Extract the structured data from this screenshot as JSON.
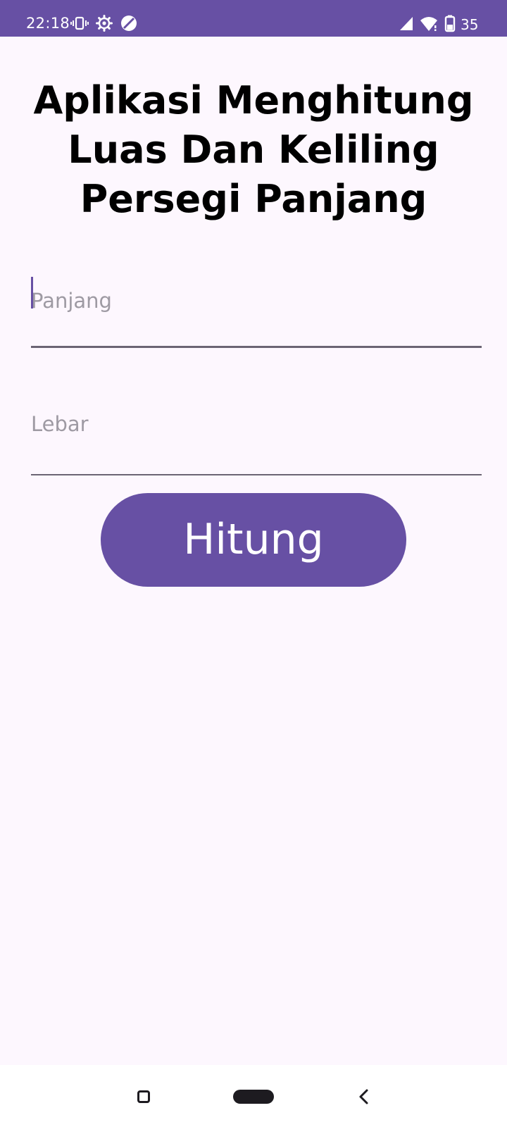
{
  "status_bar": {
    "time": "22:18",
    "battery_percent": "35",
    "icons": [
      "vibrate-icon",
      "settings-gear-icon",
      "data-saver-icon",
      "cell-signal-icon",
      "wifi-icon",
      "battery-icon"
    ],
    "background_color": "#6750a4"
  },
  "title": "Aplikasi Menghitung Luas Dan Keliling Persegi Panjang",
  "form": {
    "panjang": {
      "placeholder": "Panjang",
      "value": ""
    },
    "lebar": {
      "placeholder": "Lebar",
      "value": ""
    },
    "submit_label": "Hitung"
  },
  "nav_bar": {
    "icons": [
      "recents-icon",
      "home-pill-icon",
      "back-icon"
    ]
  },
  "colors": {
    "accent": "#6750a4",
    "background": "#fdf7fe",
    "placeholder": "#9e9aa3"
  }
}
